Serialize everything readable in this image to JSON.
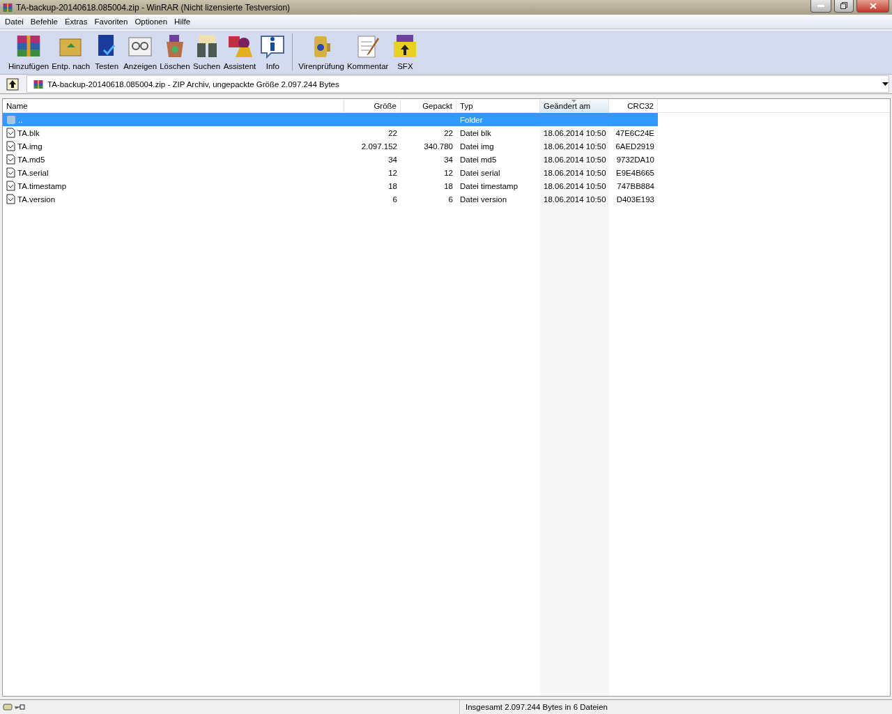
{
  "window": {
    "title": "TA-backup-20140618.085004.zip - WinRAR (Nicht lizensierte Testversion)"
  },
  "menu": [
    "Datei",
    "Befehle",
    "Extras",
    "Favoriten",
    "Optionen",
    "Hilfe"
  ],
  "toolbar": [
    {
      "label": "Hinzufügen"
    },
    {
      "label": "Entp. nach"
    },
    {
      "label": "Testen"
    },
    {
      "label": "Anzeigen"
    },
    {
      "label": "Löschen"
    },
    {
      "label": "Suchen"
    },
    {
      "label": "Assistent"
    },
    {
      "label": "Info"
    },
    {
      "label": "Virenprüfung"
    },
    {
      "label": "Kommentar"
    },
    {
      "label": "SFX"
    }
  ],
  "address": {
    "path": "TA-backup-20140618.085004.zip - ZIP Archiv, ungepackte Größe 2.097.244 Bytes"
  },
  "table": {
    "columns": [
      {
        "label": "Name",
        "sorted": false
      },
      {
        "label": "Größe",
        "sorted": false
      },
      {
        "label": "Gepackt",
        "sorted": false
      },
      {
        "label": "Typ",
        "sorted": false
      },
      {
        "label": "Geändert am",
        "sorted": true
      },
      {
        "label": "CRC32",
        "sorted": false
      }
    ],
    "rows": [
      {
        "kind": "folder",
        "selected": true,
        "cells": [
          "..",
          "",
          "",
          "Folder",
          "",
          ""
        ]
      },
      {
        "kind": "file",
        "selected": false,
        "cells": [
          "TA.blk",
          "22",
          "22",
          "Datei blk",
          "18.06.2014 10:50",
          "47E6C24E"
        ]
      },
      {
        "kind": "file",
        "selected": false,
        "cells": [
          "TA.img",
          "2.097.152",
          "340.780",
          "Datei img",
          "18.06.2014 10:50",
          "6AED2919"
        ]
      },
      {
        "kind": "file",
        "selected": false,
        "cells": [
          "TA.md5",
          "34",
          "34",
          "Datei md5",
          "18.06.2014 10:50",
          "9732DA10"
        ]
      },
      {
        "kind": "file",
        "selected": false,
        "cells": [
          "TA.serial",
          "12",
          "12",
          "Datei serial",
          "18.06.2014 10:50",
          "E9E4B665"
        ]
      },
      {
        "kind": "file",
        "selected": false,
        "cells": [
          "TA.timestamp",
          "18",
          "18",
          "Datei timestamp",
          "18.06.2014 10:50",
          "747BB884"
        ]
      },
      {
        "kind": "file",
        "selected": false,
        "cells": [
          "TA.version",
          "6",
          "6",
          "Datei version",
          "18.06.2014 10:50",
          "D403E193"
        ]
      }
    ]
  },
  "status_bar": {
    "text": "Insgesamt 2.097.244 Bytes in 6 Dateien"
  }
}
